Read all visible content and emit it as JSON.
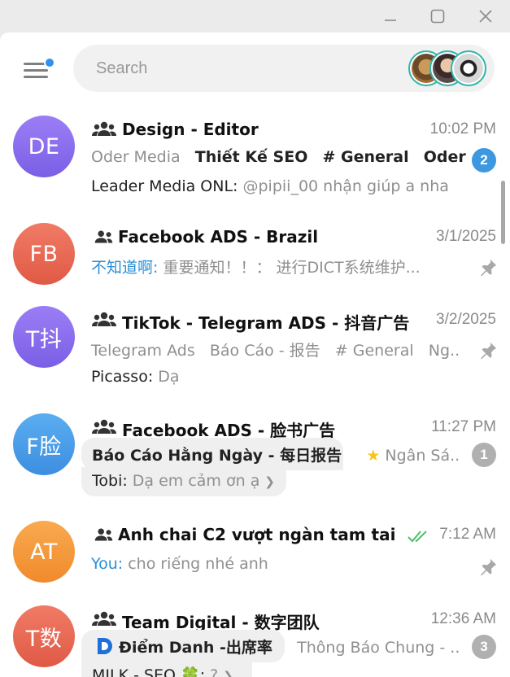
{
  "search": {
    "placeholder": "Search"
  },
  "colors": {
    "accent": "#3390ec",
    "unread_badge": "#3d98e0",
    "muted_badge": "#b0b0b0",
    "read_check": "#4fbf67"
  },
  "chats": [
    {
      "initials": "DE",
      "avatar_color": "#8a6ff0",
      "title": "Design - Editor",
      "time": "10:02 PM",
      "line2": [
        {
          "text": "Oder Media",
          "style": "grey"
        },
        {
          "text": "Thiết Kế SEO",
          "style": "bold"
        },
        {
          "text": "# General",
          "style": "bold"
        },
        {
          "text": "Oder ...",
          "style": "bold"
        }
      ],
      "sender": "Leader Media ONL:",
      "message": "@pipii_00 nhận giúp a nha",
      "badge": "2"
    },
    {
      "initials": "FB",
      "avatar_color": "#ea6a55",
      "title": "Facebook ADS - Brazil",
      "time": "3/1/2025",
      "sender": "不知道啊:",
      "message": "重要通知！！： 进行DICT系统维护...",
      "pinned": true
    },
    {
      "initials": "T抖",
      "avatar_color": "#8a6ff0",
      "title": "TikTok - Telegram ADS - 抖音广告",
      "time": "3/2/2025",
      "line2": [
        {
          "text": "Telegram Ads",
          "style": "grey"
        },
        {
          "text": "Báo Cáo - 报告",
          "style": "grey"
        },
        {
          "text": "# General",
          "style": "grey"
        },
        {
          "text": "Ng...",
          "style": "grey"
        }
      ],
      "sender": "Picasso:",
      "message": "Dạ",
      "pinned": true
    },
    {
      "initials": "F脸",
      "avatar_color": "#4a9ee8",
      "title": "Facebook ADS - 脸书广告",
      "time": "11:27 PM",
      "topic_main": "Báo Cáo Hằng Ngày - 每日报告",
      "topic_next": "Ngân Sá...",
      "sender": "Tobi:",
      "message": "Dạ em cảm ơn ạ",
      "badge": "1"
    },
    {
      "initials": "AT",
      "avatar_color": "#f59a3c",
      "title": "Anh chai C2 vượt ngàn tam tai",
      "time": "7:12 AM",
      "sender": "You:",
      "message": "cho riếng nhé anh",
      "pinned": true
    },
    {
      "initials": "T数",
      "avatar_color": "#ea6a55",
      "title": "Team Digital - 数字团队",
      "time": "12:36 AM",
      "topic_main": "Điểm Danh -出席率",
      "topic_next": "Thông Báo Chung - ...",
      "sender": "MILK - SEO 🍀:",
      "message": "?",
      "badge": "3"
    }
  ]
}
